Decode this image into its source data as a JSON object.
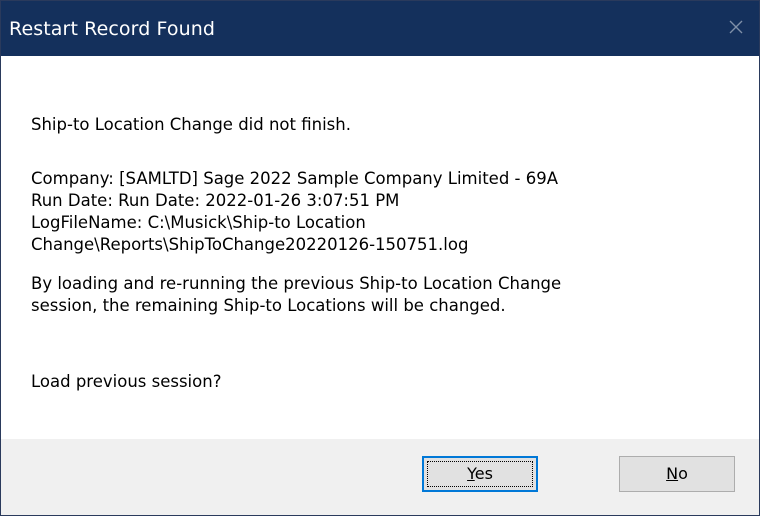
{
  "window": {
    "title": "Restart Record Found",
    "close_icon": "close-icon"
  },
  "message": {
    "line1": "Ship-to Location Change did not finish.",
    "details": [
      "Company:  [SAMLTD] Sage 2022 Sample Company Limited  - 69A",
      "Run Date: Run Date: 2022-01-26  3:07:51 PM",
      "LogFileName: C:\\Musick\\Ship-to Location",
      "Change\\Reports\\ShipToChange20220126-150751.log"
    ],
    "explanation": [
      "By loading and re-running the previous Ship-to Location Change",
      "session, the remaining Ship-to Locations  will be changed."
    ],
    "question": "Load previous session?"
  },
  "buttons": {
    "yes": {
      "mnemonic": "Y",
      "rest": "es"
    },
    "no": {
      "mnemonic": "N",
      "rest": "o"
    }
  },
  "colors": {
    "titlebar": "#14305c",
    "footer": "#f0f0f0",
    "focus_border": "#0078d7"
  }
}
